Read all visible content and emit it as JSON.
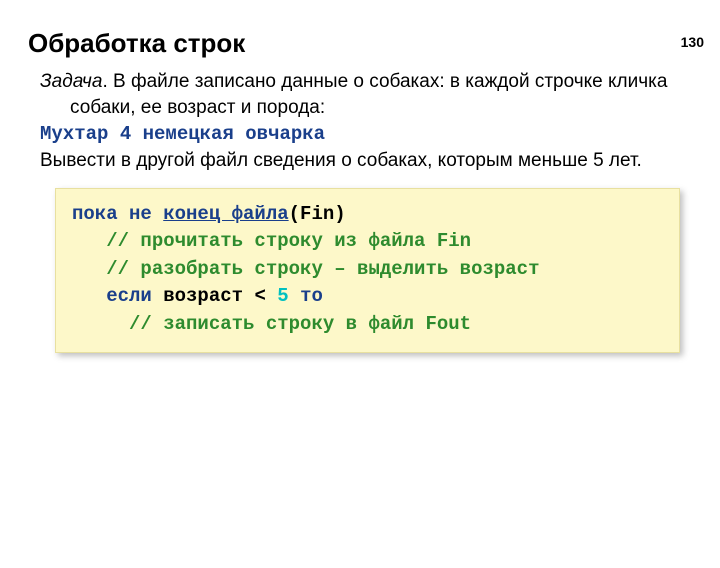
{
  "page_number": "130",
  "title": "Обработка строк",
  "task": {
    "label": "Задача",
    "desc1": ". В файле записано данные о собаках: в каждой строчке кличка собаки, ее возраст и порода:",
    "example": "Мухтар 4 немецкая овчарка",
    "desc2": "Вывести в другой файл сведения о собаках, которым меньше 5 лет."
  },
  "code": {
    "l1_kw1": "пока не ",
    "l1_fn": "конец файла",
    "l1_rest": "(Fin)",
    "l2": "   // прочитать строку из файла Fin",
    "l3": "   // разобрать строку – выделить возраст",
    "l4_pre": "   ",
    "l4_kw1": "если",
    "l4_mid": " возраст < ",
    "l4_num": "5",
    "l4_sp": " ",
    "l4_kw2": "то",
    "l5": "     // записать строку в файл Fout"
  }
}
